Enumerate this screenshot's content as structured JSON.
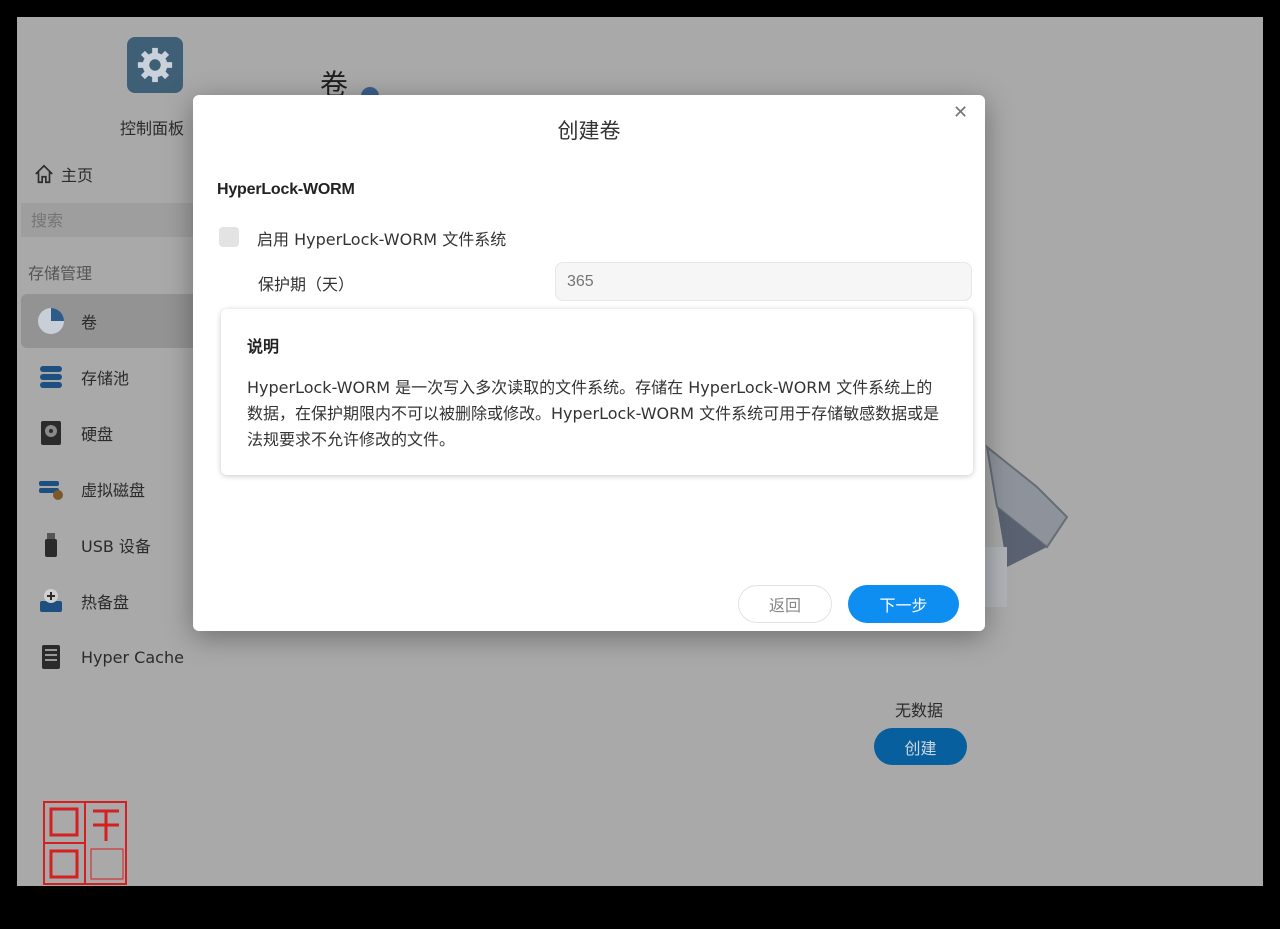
{
  "app": {
    "title": "控制面板",
    "icon": "gear-icon",
    "accent_color": "#0d8ef0"
  },
  "sidebar": {
    "home_label": "主页",
    "search_placeholder": "搜索",
    "section_label": "存储管理",
    "items": [
      {
        "label": "卷",
        "icon": "volume-pie-icon",
        "active": true
      },
      {
        "label": "存储池",
        "icon": "storage-pool-icon",
        "active": false
      },
      {
        "label": "硬盘",
        "icon": "hard-disk-icon",
        "active": false
      },
      {
        "label": "虚拟磁盘",
        "icon": "virtual-disk-icon",
        "active": false
      },
      {
        "label": "USB 设备",
        "icon": "usb-device-icon",
        "active": false
      },
      {
        "label": "热备盘",
        "icon": "hot-spare-icon",
        "active": false
      },
      {
        "label": "Hyper Cache",
        "icon": "ssd-cache-icon",
        "active": false
      }
    ]
  },
  "main": {
    "page_title": "卷",
    "empty_text": "无数据",
    "create_label": "创建"
  },
  "modal": {
    "title": "创建卷",
    "section_heading": "HyperLock-WORM",
    "enable_label": "启用 HyperLock-WORM 文件系统",
    "enable_checked": false,
    "period_label": "保护期（天）",
    "period_placeholder": "365",
    "description_title": "说明",
    "description_text": "HyperLock-WORM 是一次写入多次读取的文件系统。存储在 HyperLock-WORM 文件系统上的数据，在保护期限内不可以被删除或修改。HyperLock-WORM 文件系统可用于存储敏感数据或是法规要求不允许修改的文件。",
    "back_label": "返回",
    "next_label": "下一步"
  },
  "watermark": {
    "text": "昭华凋 Zhao Hua Diao",
    "color": "#d42020"
  }
}
